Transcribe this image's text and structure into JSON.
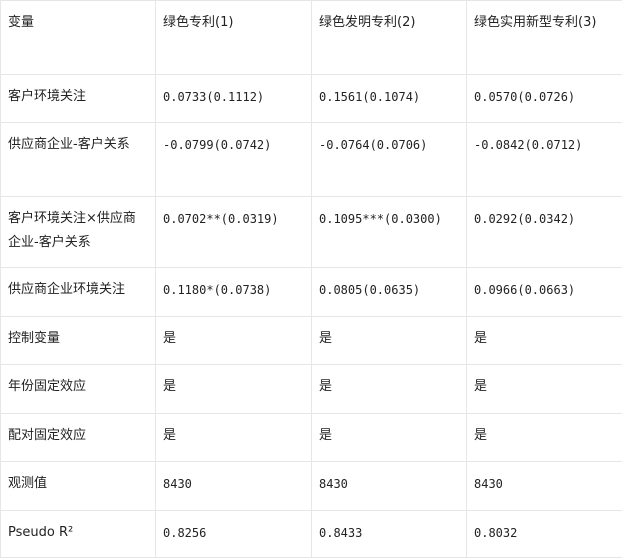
{
  "header": [
    "变量",
    "绿色专利(1)",
    "绿色发明专利(2)",
    "绿色实用新型专利(3)"
  ],
  "rows": [
    {
      "label": "客户环境关注",
      "values": [
        "0.0733(0.1112)",
        "0.1561(0.1074)",
        "0.0570(0.0726)"
      ]
    },
    {
      "label": "供应商企业-客户关系",
      "values": [
        "-0.0799(0.0742)",
        "-0.0764(0.0706)",
        "-0.0842(0.0712)"
      ]
    },
    {
      "label": "客户环境关注×供应商企业-客户关系",
      "values": [
        "0.0702**(0.0319)",
        "0.1095***(0.0300)",
        "0.0292(0.0342)"
      ]
    },
    {
      "label": "供应商企业环境关注",
      "values": [
        "0.1180*(0.0738)",
        "0.0805(0.0635)",
        "0.0966(0.0663)"
      ]
    },
    {
      "label": "控制变量",
      "values": [
        "是",
        "是",
        "是"
      ]
    },
    {
      "label": "年份固定效应",
      "values": [
        "是",
        "是",
        "是"
      ]
    },
    {
      "label": "配对固定效应",
      "values": [
        "是",
        "是",
        "是"
      ]
    },
    {
      "label": "观测值",
      "values": [
        "8430",
        "8430",
        "8430"
      ]
    },
    {
      "label": "Pseudo R²",
      "values": [
        "0.8256",
        "0.8433",
        "0.8032"
      ]
    }
  ]
}
